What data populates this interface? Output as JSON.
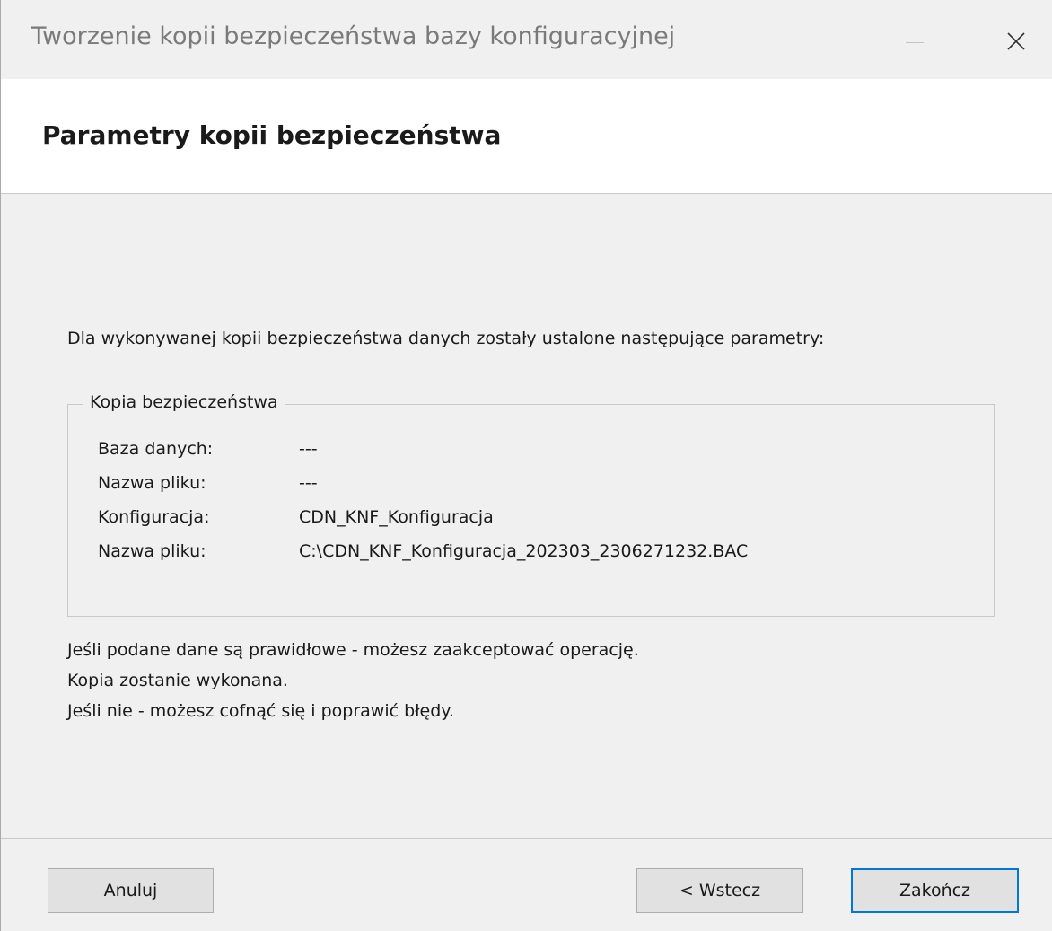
{
  "window": {
    "title": "Tworzenie kopii bezpieczeństwa bazy konfiguracyjnej",
    "minimize_icon": "minimize-icon",
    "close_icon": "close-icon"
  },
  "header": {
    "title": "Parametry kopii bezpieczeństwa"
  },
  "content": {
    "intro": "Dla wykonywanej kopii bezpieczeństwa danych zostały ustalone następujące parametry:",
    "group": {
      "legend": "Kopia bezpieczeństwa",
      "rows": [
        {
          "label": "Baza danych:",
          "value": "---"
        },
        {
          "label": "Nazwa pliku:",
          "value": "---"
        },
        {
          "label": "Konfiguracja:",
          "value": "CDN_KNF_Konfiguracja"
        },
        {
          "label": "Nazwa pliku:",
          "value": "C:\\CDN_KNF_Konfiguracja_202303_2306271232.BAC"
        }
      ]
    },
    "notes": [
      "Jeśli podane dane są prawidłowe - możesz zaakceptować operację.",
      "Kopia zostanie wykonana.",
      "Jeśli nie - możesz cofnąć się i poprawić błędy."
    ]
  },
  "footer": {
    "cancel_label": "Anuluj",
    "back_label": "< Wstecz",
    "finish_label": "Zakończ"
  },
  "colors": {
    "accent": "#0078d7",
    "background": "#f0f0f0"
  }
}
